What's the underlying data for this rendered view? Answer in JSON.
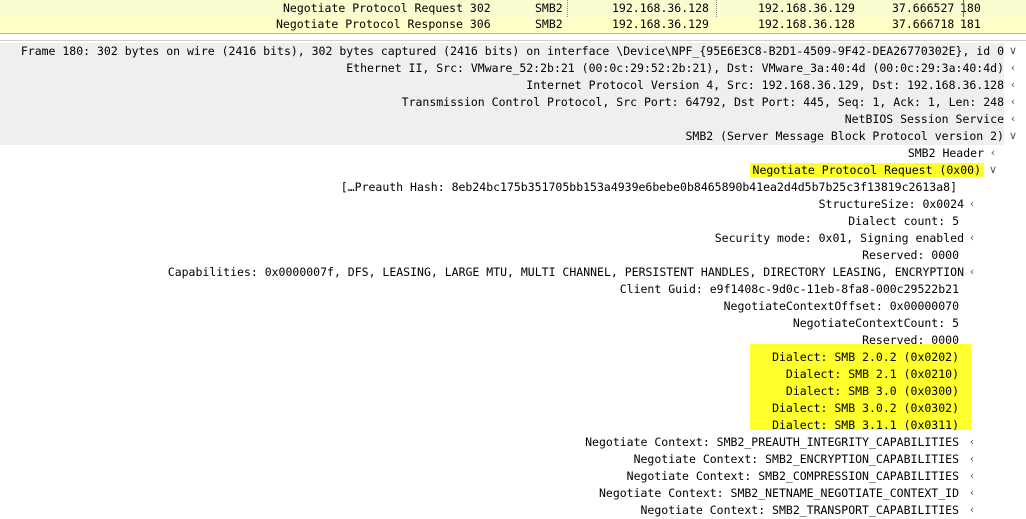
{
  "packet_list": {
    "rows": [
      {
        "info": "Negotiate Protocol Request 302",
        "protocol": "SMB2",
        "source": "192.168.36.128",
        "destination": "192.168.36.129",
        "time": "37.666527",
        "number": "180"
      },
      {
        "info": "Negotiate Protocol Response 306",
        "protocol": "SMB2",
        "source": "192.168.36.129",
        "destination": "192.168.36.128",
        "time": "37.666718",
        "number": "181"
      }
    ]
  },
  "details": {
    "frame": "Frame 180: 302 bytes on wire (2416 bits), 302 bytes captured (2416 bits) on interface \\Device\\NPF_{95E6E3C8-B2D1-4509-9F42-DEA26770302E}, id 0",
    "ethernet": "Ethernet II, Src: VMware_52:2b:21 (00:0c:29:52:2b:21), Dst: VMware_3a:40:4d (00:0c:29:3a:40:4d)",
    "ip": "Internet Protocol Version 4, Src: 192.168.36.129, Dst: 192.168.36.128",
    "tcp": "Transmission Control Protocol, Src Port: 64792, Dst Port: 445, Seq: 1, Ack: 1, Len: 248",
    "netbios": "NetBIOS Session Service",
    "smb2": "SMB2 (Server Message Block Protocol version 2)",
    "smb2_header": "SMB2 Header",
    "negotiate_request": "Negotiate Protocol Request (0x00)",
    "preauth_hash": "[…Preauth Hash: 8eb24bc175b351705bb153a4939e6bebe0b8465890b41ea2d4d5b7b25c3f13819c2613a8]",
    "structure_size": "StructureSize: 0x0024",
    "dialect_count": "Dialect count: 5",
    "security_mode": "Security mode: 0x01, Signing enabled",
    "reserved1": "Reserved: 0000",
    "capabilities": "Capabilities: 0x0000007f, DFS, LEASING, LARGE MTU, MULTI CHANNEL, PERSISTENT HANDLES, DIRECTORY LEASING, ENCRYPTION",
    "client_guid": "Client Guid: e9f1408c-9d0c-11eb-8fa8-000c29522b21",
    "neg_ctx_offset": "NegotiateContextOffset: 0x00000070",
    "neg_ctx_count": "NegotiateContextCount: 5",
    "reserved2": "Reserved: 0000",
    "dialects": [
      "Dialect: SMB 2.0.2 (0x0202)",
      "Dialect: SMB 2.1 (0x0210)",
      "Dialect: SMB 3.0 (0x0300)",
      "Dialect: SMB 3.0.2 (0x0302)",
      "Dialect: SMB 3.1.1 (0x0311)"
    ],
    "contexts": [
      "Negotiate Context: SMB2_PREAUTH_INTEGRITY_CAPABILITIES",
      "Negotiate Context: SMB2_ENCRYPTION_CAPABILITIES",
      "Negotiate Context: SMB2_COMPRESSION_CAPABILITIES",
      "Negotiate Context: SMB2_NETNAME_NEGOTIATE_CONTEXT_ID",
      "Negotiate Context: SMB2_TRANSPORT_CAPABILITIES"
    ]
  },
  "icons": {
    "collapsed": "chevron-left-icon",
    "expanded": "chevron-down-icon"
  },
  "colors": {
    "highlight": "#ffff2b",
    "packet_row": "#ffffc8",
    "expanded_bg": "#efefef"
  }
}
